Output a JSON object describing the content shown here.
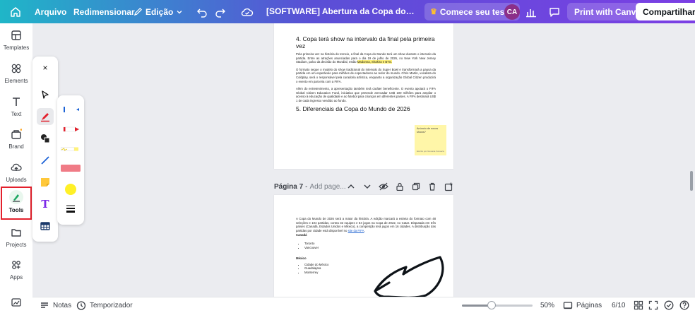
{
  "topbar": {
    "menu_arquivo": "Arquivo",
    "menu_redimensionar": "Redimensionar",
    "menu_edicao": "Edição",
    "document_title": "[SOFTWARE] Abertura da Copa do Mundo hoje",
    "trial_button": "Comece seu test...",
    "avatar_initials": "CA",
    "print_button": "Print with Canva",
    "share_button": "Compartilhar"
  },
  "sidebar": {
    "items": [
      {
        "label": "Templates",
        "icon": "templates-icon"
      },
      {
        "label": "Elements",
        "icon": "elements-icon"
      },
      {
        "label": "Text",
        "icon": "text-icon"
      },
      {
        "label": "Brand",
        "icon": "brand-icon"
      },
      {
        "label": "Uploads",
        "icon": "uploads-icon"
      },
      {
        "label": "Tools",
        "icon": "tools-icon"
      },
      {
        "label": "Projects",
        "icon": "projects-icon"
      },
      {
        "label": "Apps",
        "icon": "apps-icon"
      }
    ]
  },
  "tools": {
    "close": "×",
    "text_tool_glyph": "T"
  },
  "page6": {
    "heading4": "4. Copa terá show na intervalo da final pela primeira vez",
    "para1_a": "Pela primeira vez na história do torneio, a final da Copa do Mundo terá um show durante o intervalo da partida. Entre as atrações anunciadas para o dia 19 de julho de 2026, no New York New Jersey Stadium, palco da decisão do Mundial, estão ",
    "para1_highlight": "Madonna, Shakira e BTS.",
    "para2": "O formato segue o modelo do show tradicional do intervalo do Super Bowl e transformará a pausa da partida em um espetáculo para milhões de espectadores ao redor do mundo. Chris Martin, vocalista do Coldplay, será o responsável pela curadoria artística, enquanto a organização Global Citizen produzirá o evento em parceria com a FIFA.",
    "para3": "Além do entretenimento, a apresentação também terá caráter beneficente. O evento apoiará o FIFA Global Citizen Education Fund, iniciativa que pretende arrecadar US$ 100 milhões para ampliar o acesso à educação de qualidade e ao futebol para crianças em diferentes países. A FIFA destinará US$ 1 de cada ingresso vendido ao fundo.",
    "heading5": "5. Diferenciais da Copa do Mundo de 2026",
    "sticky_text": "Anúncio de novos shows?",
    "sticky_signature": "Escrito por Giovana Fonseca"
  },
  "page_header": {
    "label": "Página 7",
    "add_title": "Add page..."
  },
  "page7": {
    "para1": "A Copa do Mundo de 2026 será a maior da história. A edição marcará a estreia do formato com 48 seleções e 104 partidas, contra 32 equipes e 64 jogos na Copa de 2022, no Catar. Disputada em três países (Canadá, Estados Unidos e México), a competição terá jogos em 16 cidades. A distribuição das partidas por cidade está disponível no ",
    "link": "site da FIFA",
    "para1_end": ".",
    "canada_title": "Canadá",
    "canada_cities": [
      "Toronto",
      "Vancouver"
    ],
    "mexico_title": "México",
    "mexico_cities": [
      "Cidade do México",
      "Guadalajara",
      "Monterrey"
    ]
  },
  "bottombar": {
    "notes": "Notas",
    "timer": "Temporizador",
    "zoom_label": "50%",
    "zoom_fraction": 0.42,
    "pages_label": "Páginas",
    "page_count": "6/10"
  },
  "colors": {
    "highlight": "#fff27a",
    "sticky_note": "#fff6a8",
    "tools_outline": "#e3202c",
    "brand_gradient_start": "#1fb6c8",
    "brand_gradient_end": "#7b3fe4"
  }
}
